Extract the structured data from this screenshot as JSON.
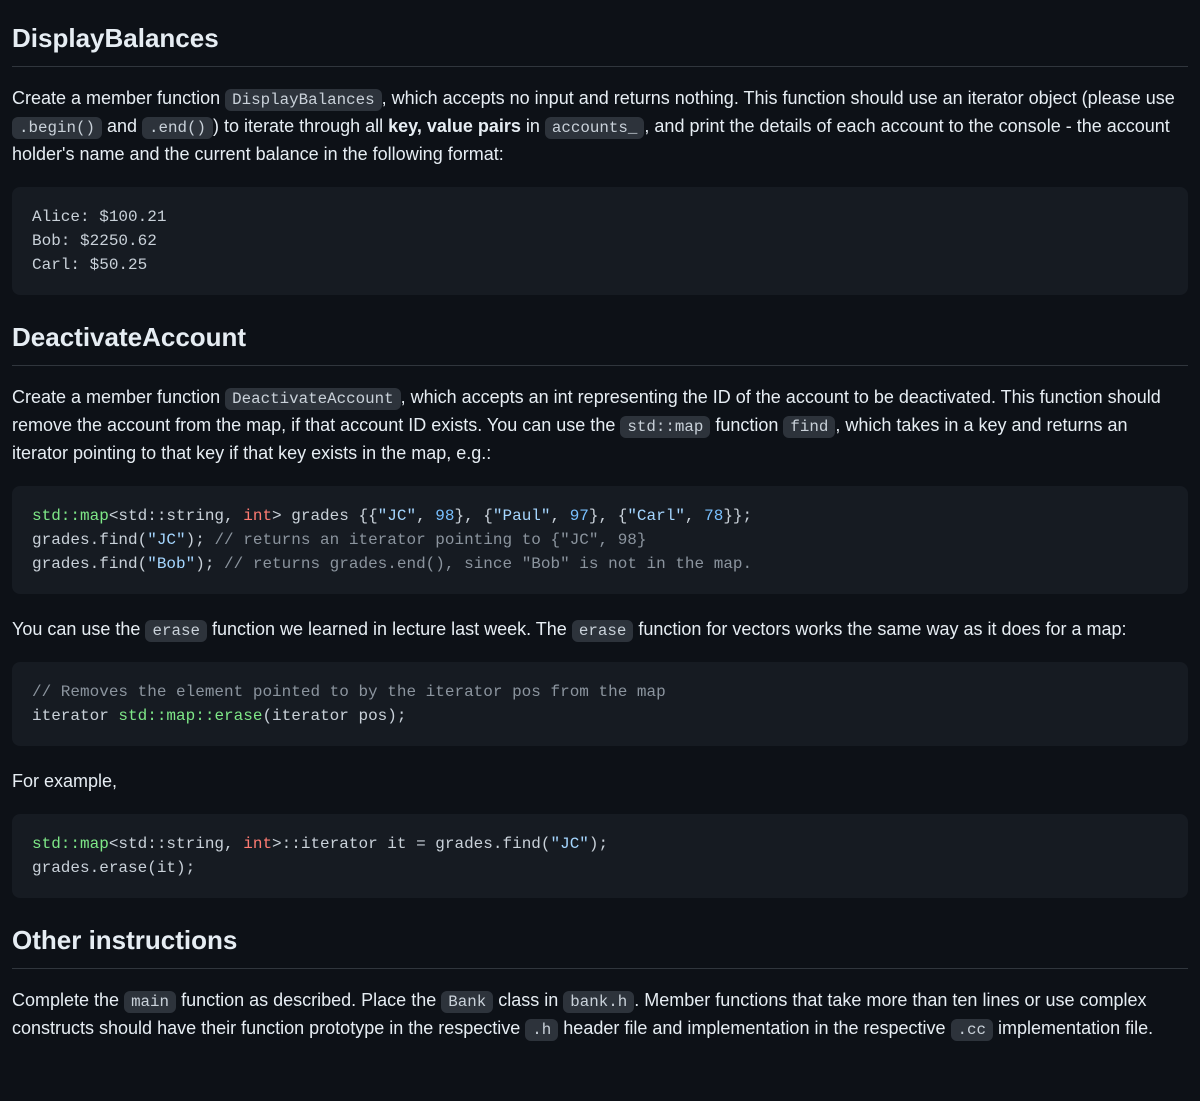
{
  "s1": {
    "heading": "DisplayBalances",
    "p": {
      "t1": "Create a member function ",
      "c1": "DisplayBalances",
      "t2": ", which accepts no input and returns nothing. This function should use an iterator object (please use ",
      "c2": ".begin()",
      "t3": " and ",
      "c3": ".end()",
      "t4": ") to iterate through all ",
      "b1": "key, value pairs",
      "t5": " in ",
      "c4": "accounts_",
      "t6": ", and print the details of each account to the console - the account holder's name and the current balance in the following format:"
    },
    "code": "Alice: $100.21\nBob: $2250.62\nCarl: $50.25"
  },
  "s2": {
    "heading": "DeactivateAccount",
    "p1": {
      "t1": "Create a member function ",
      "c1": "DeactivateAccount",
      "t2": ", which accepts an int representing the ID of the account to be deactivated. This function should remove the account from the map, if that account ID exists. You can use the ",
      "c2": "std::map",
      "t3": " function ",
      "c3": "find",
      "t4": ", which takes in a key and returns an iterator pointing to that key if that key exists in the map, e.g.:"
    },
    "code1": {
      "l1a": "std::map",
      "l1b": "<std::string, ",
      "l1c": "int",
      "l1d": "> grades {{",
      "l1e": "\"JC\"",
      "l1f": ", ",
      "l1g": "98",
      "l1h": "}, {",
      "l1i": "\"Paul\"",
      "l1j": ", ",
      "l1k": "97",
      "l1l": "}, {",
      "l1m": "\"Carl\"",
      "l1n": ", ",
      "l1o": "78",
      "l1p": "}};",
      "l2a": "grades.find(",
      "l2b": "\"JC\"",
      "l2c": "); ",
      "l2d": "// returns an iterator pointing to {\"JC\", 98}",
      "l3a": "grades.find(",
      "l3b": "\"Bob\"",
      "l3c": "); ",
      "l3d": "// returns grades.end(), since \"Bob\" is not in the map."
    },
    "p2": {
      "t1": "You can use the ",
      "c1": "erase",
      "t2": " function we learned in lecture last week. The ",
      "c2": "erase",
      "t3": " function for vectors works the same way as it does for a map:"
    },
    "code2": {
      "l1": "// Removes the element pointed to by the iterator pos from the map",
      "l2a": "iterator ",
      "l2b": "std::map::erase",
      "l2c": "(iterator pos);"
    },
    "p3": "For example,",
    "code3": {
      "l1a": "std::map",
      "l1b": "<std::string, ",
      "l1c": "int",
      "l1d": ">::iterator it = grades.find(",
      "l1e": "\"JC\"",
      "l1f": ");",
      "l2": "grades.erase(it);"
    }
  },
  "s3": {
    "heading": "Other instructions",
    "p": {
      "t1": "Complete the ",
      "c1": "main",
      "t2": " function as described. Place the ",
      "c2": "Bank",
      "t3": " class in ",
      "c3": "bank.h",
      "t4": ". Member functions that take more than ten lines or use complex constructs should have their function prototype in the respective ",
      "c4": ".h",
      "t5": " header file and implementation in the respective ",
      "c5": ".cc",
      "t6": " implementation file."
    }
  }
}
